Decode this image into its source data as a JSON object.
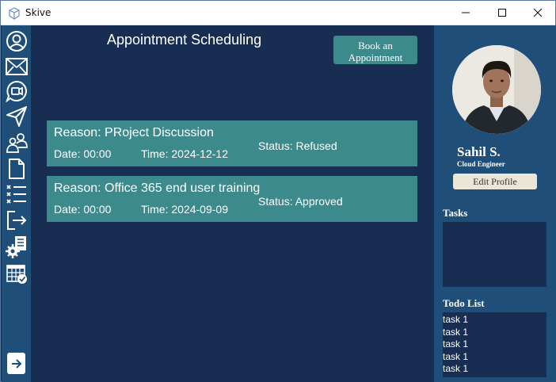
{
  "window": {
    "title": "Skive",
    "app_icon": "cube-icon",
    "controls": [
      "minimize-icon",
      "maximize-icon",
      "close-icon"
    ]
  },
  "sidebar": {
    "icons": [
      "user-circle-icon",
      "mail-icon",
      "video-chat-icon",
      "send-icon",
      "users-icon",
      "document-icon",
      "checklist-icon",
      "logout-icon",
      "settings-document-icon",
      "calendar-check-icon"
    ],
    "bottom_icon": "arrow-right-icon"
  },
  "main": {
    "title": "Appointment Scheduling",
    "book_button": "Book an Appointment",
    "appointments": [
      {
        "reason": "Reason: PRoject Discussion",
        "date": "Date: 00:00",
        "time": "Time: 2024-12-12",
        "status": "Status: Refused"
      },
      {
        "reason": "Reason: Office 365 end user training",
        "date": "Date: 00:00",
        "time": "Time: 2024-09-09",
        "status": "Status: Approved"
      }
    ]
  },
  "profile": {
    "name": "Sahil S.",
    "role": "Cloud Engineer",
    "edit_button": "Edit Profile",
    "tasks_title": "Tasks",
    "todo_title": "Todo List",
    "todo_items": [
      "task 1",
      "task 1",
      "task 1",
      "task 1",
      "task 1"
    ]
  },
  "colors": {
    "main_bg": "#172d52",
    "panel_bg": "#1f4e78",
    "accent_teal": "#3c8a8c",
    "button_light": "#ebe6d6"
  }
}
